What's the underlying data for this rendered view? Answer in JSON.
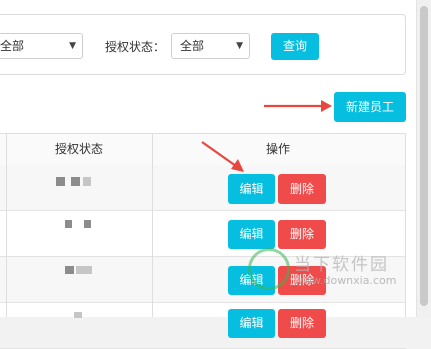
{
  "filters": {
    "first_select_value": "全部",
    "auth_status_label": "授权状态：",
    "auth_status_value": "全部",
    "query_button": "查询"
  },
  "toolbar": {
    "new_employee_button": "新建员工"
  },
  "table": {
    "columns": [
      "授权状态",
      "操作"
    ],
    "rows": [
      {
        "edit": "编辑",
        "delete": "删除"
      },
      {
        "edit": "编辑",
        "delete": "删除"
      },
      {
        "edit": "编辑",
        "delete": "删除"
      },
      {
        "edit": "编辑",
        "delete": "删除"
      }
    ]
  },
  "watermark": {
    "title": "当下软件园",
    "url": "www.downxia.com"
  },
  "colors": {
    "accent_cyan": "#06bfe0",
    "danger_red": "#f04b4b",
    "arrow_red": "#e8463f"
  }
}
